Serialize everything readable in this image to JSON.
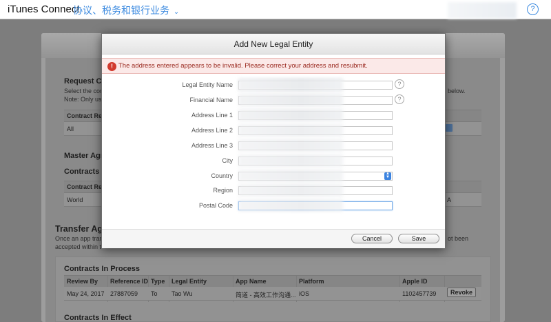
{
  "topbar": {
    "brand": "iTunes Connect",
    "menu_label": "协议、税务和银行业务",
    "menu_chevron_glyph": "⌄",
    "help_glyph": "?"
  },
  "background": {
    "request_title": "Request Co",
    "request_desc_1": "Select the con",
    "request_desc_2": "Note: Only use",
    "request_desc_right": "below.",
    "contract_region_header": "Contract Regi",
    "contract_region_value": "All",
    "master_title": "Master Agre",
    "contracts_in_title": "Contracts In",
    "contract_region_header_2": "Contract Regi",
    "world_value": "World",
    "a_value": "A",
    "transfer_title": "Transfer Agr",
    "transfer_desc_1": "Once an app trans",
    "transfer_desc_2": "accepted within t",
    "not_been": "ot been",
    "contracts_in_process_title": "Contracts In Process",
    "process_table": {
      "headers": [
        "Review By",
        "Reference ID",
        "Type",
        "Legal Entity",
        "App Name",
        "Platform",
        "Apple ID"
      ],
      "row": [
        "May 24, 2017",
        "27887059",
        "To",
        "Tao Wu",
        "简道 - 高效工作沟通...",
        "iOS",
        "1102457739"
      ],
      "action": "Revoke"
    },
    "contracts_in_effect_title": "Contracts In Effect"
  },
  "modal": {
    "title": "Add New Legal Entity",
    "error_glyph": "!",
    "error_message": "The address entered appears to be invalid. Please correct your address and resubmit.",
    "info_glyph": "?",
    "fields": [
      {
        "label": "Legal Entity Name",
        "value": ""
      },
      {
        "label": "Financial Name",
        "value": ""
      },
      {
        "label": "Address Line 1",
        "value": ""
      },
      {
        "label": "Address Line 2",
        "value": ""
      },
      {
        "label": "Address Line 3",
        "value": ""
      },
      {
        "label": "City",
        "value": ""
      },
      {
        "label": "Country",
        "value": ""
      },
      {
        "label": "Region",
        "value": ""
      },
      {
        "label": "Postal Code",
        "value": ""
      }
    ],
    "cancel_label": "Cancel",
    "save_label": "Save"
  },
  "colors": {
    "accent": "#3d8be0",
    "error_red": "#d23a2e",
    "error_bg": "#fbe9e8"
  }
}
